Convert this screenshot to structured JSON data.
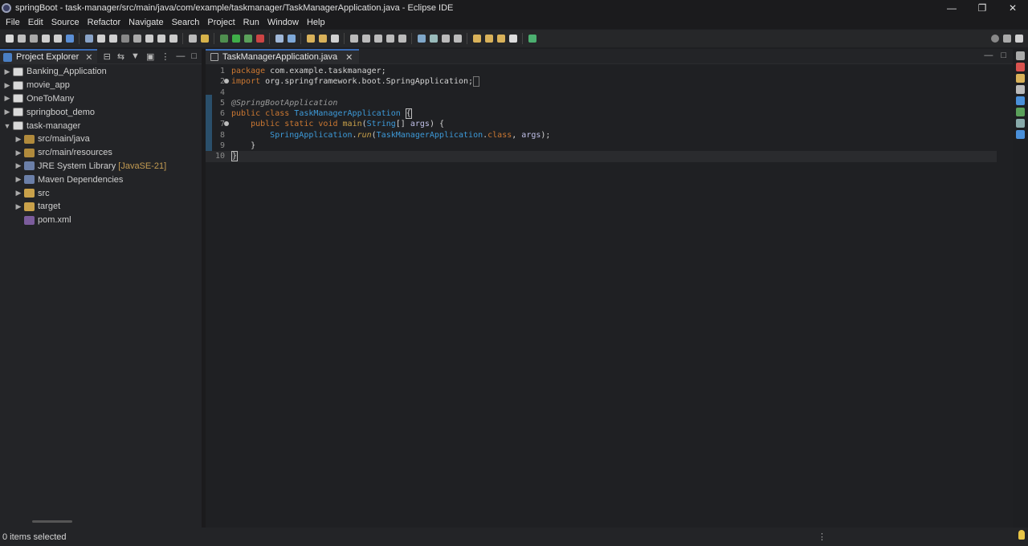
{
  "window": {
    "title": "springBoot - task-manager/src/main/java/com/example/taskmanager/TaskManagerApplication.java - Eclipse IDE",
    "controls": {
      "minimize": "—",
      "maximize": "❐",
      "close": "✕"
    }
  },
  "menu": [
    "File",
    "Edit",
    "Source",
    "Refactor",
    "Navigate",
    "Search",
    "Project",
    "Run",
    "Window",
    "Help"
  ],
  "explorer": {
    "tab_label": "Project Explorer",
    "items": [
      {
        "label": "Banking_Application",
        "icon": "project-icon",
        "level": 0,
        "expanded": false
      },
      {
        "label": "movie_app",
        "icon": "project-icon",
        "level": 0,
        "expanded": false
      },
      {
        "label": "OneToMany",
        "icon": "project-icon",
        "level": 0,
        "expanded": false
      },
      {
        "label": "springboot_demo",
        "icon": "project-icon",
        "level": 0,
        "expanded": false
      },
      {
        "label": "task-manager",
        "icon": "project-icon",
        "level": 0,
        "expanded": true
      },
      {
        "label": "src/main/java",
        "icon": "source-folder-icon",
        "level": 1,
        "expanded": false
      },
      {
        "label": "src/main/resources",
        "icon": "source-folder-icon",
        "level": 1,
        "expanded": false
      },
      {
        "label": "JRE System Library",
        "decoration": "[JavaSE-21]",
        "icon": "library-icon",
        "level": 1,
        "expanded": false
      },
      {
        "label": "Maven Dependencies",
        "icon": "library-icon",
        "level": 1,
        "expanded": false
      },
      {
        "label": "src",
        "icon": "folder-icon",
        "level": 1,
        "expanded": false
      },
      {
        "label": "target",
        "icon": "folder-icon",
        "level": 1,
        "expanded": false
      },
      {
        "label": "pom.xml",
        "icon": "xml-file-icon",
        "level": 1,
        "expanded": null
      }
    ]
  },
  "editor": {
    "tab_label": "TaskManagerApplication.java",
    "lines": [
      {
        "n": "1",
        "text": "package com.example.taskmanager;"
      },
      {
        "n": "2",
        "text": "import org.springframework.boot.SpringApplication;"
      },
      {
        "n": "4",
        "text": ""
      },
      {
        "n": "5",
        "text": "@SpringBootApplication"
      },
      {
        "n": "6",
        "text": "public class TaskManagerApplication {"
      },
      {
        "n": "7",
        "text": "    public static void main(String[] args) {"
      },
      {
        "n": "8",
        "text": "        SpringApplication.run(TaskManagerApplication.class, args);"
      },
      {
        "n": "9",
        "text": "    }"
      },
      {
        "n": "10",
        "text": "}"
      }
    ]
  },
  "status": {
    "text": "0 items selected"
  }
}
